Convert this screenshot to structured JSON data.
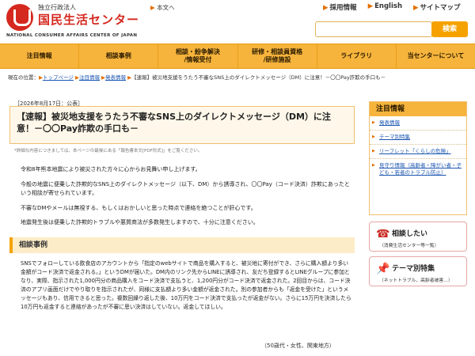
{
  "header": {
    "org_type": "独立行政法人",
    "org_name": "国民生活センター",
    "org_en": "NATIONAL CONSUMER AFFAIRS CENTER OF JAPAN",
    "text_only": "本文へ",
    "links": [
      "採用情報",
      "English",
      "サイトマップ"
    ],
    "search_placeholder": "",
    "search_button": "検索"
  },
  "nav": [
    {
      "label": "注目情報",
      "sub": ""
    },
    {
      "label": "相談事例",
      "sub": ""
    },
    {
      "label": "相談・紛争解決",
      "sub": "/情報受付"
    },
    {
      "label": "研修・相談員資格",
      "sub": "/研修施設"
    },
    {
      "label": "ライブラリ",
      "sub": ""
    },
    {
      "label": "当センターについて",
      "sub": ""
    }
  ],
  "breadcrumb": {
    "prefix": "現在の位置：",
    "items": [
      "トップページ",
      "注目情報",
      "発表情報"
    ],
    "current": "【速報】被災地支援をうたう不審なSNS上のダイレクトメッセージ（DM）に注意！－〇〇Pay詐欺の手口も－"
  },
  "article": {
    "date": "［2026年8月17日：公表］",
    "title": "【速報】被災地支援をうたう不審なSNS上のダイレクトメッセージ（DM）に注意！－〇〇Pay詐欺の手口も－",
    "note": "*詳細な内容につきましては、本ページの最後にある「報告書本文[PDF形式]」をご覧ください。",
    "paragraphs": [
      "令和8年熊本地震により被災された方々に心からお見舞い申し上げます。",
      "今般の地震に便乗した詐欺的なSNS上のダイレクトメッセージ（以下、DM）から誘導され、〇〇Pay（コード決済）詐欺にあったという相談が寄せられています。",
      "不審なDMやメールは無視する、もしくはおかしいと思った時点で連絡を絶つことが肝心です。",
      "地震発生後は便乗した詐欺的トラブルや悪質商法が多数発生しますので、十分に注意ください。"
    ],
    "section_title": "相談事例",
    "case_text": "SNSでフォローしている飲食店のアカウントから「指定のwebサイトで商品を購入すると、被災地に寄付ができ、さらに購入額より多い金額がコード決済で返金される。」というDMが届いた。DM内のリンク先からLINEに誘導され、友だち登録するとLINEグループに参加となり、実際、指示された1,000円分の商品購入をコード決済で支払うと、1,200円分がコード決済で返金された。2回目からは、コード決済のアプリ画面だけでやり取りを指示されたが、同様に支払額より多い金額が返金された。別の参加者からも「返金を受けた」というメッセージもあり、信用できると思った。複数回繰り返した後、10万円をコード決済で支払ったが返金がない。さらに15万円を決済したら10万円も返金すると連絡があったが不審に思い決済はしていない。返金してほしい。",
    "signature": "（50歳代・女性、関東地方）"
  },
  "sidebar": {
    "title": "注目情報",
    "items": [
      "発表情報",
      "テーマ別特集",
      "リーフレット「くらしの危険」",
      "見守り情報（高齢者・障がい者・子ども・若者のトラブル防止）"
    ],
    "cta": [
      {
        "icon": "phone-icon",
        "title": "相談したい",
        "sub": "（消費生活センター等一覧）"
      },
      {
        "icon": "pin-icon",
        "title": "テーマ別特集",
        "sub": "（ネットトラブル、高齢者被害…）"
      }
    ]
  },
  "colors": {
    "brand_red": "#d5281f",
    "nav_orange": "#f6b43c",
    "link_blue": "#1a55b0",
    "accent_orange": "#e36f00"
  }
}
